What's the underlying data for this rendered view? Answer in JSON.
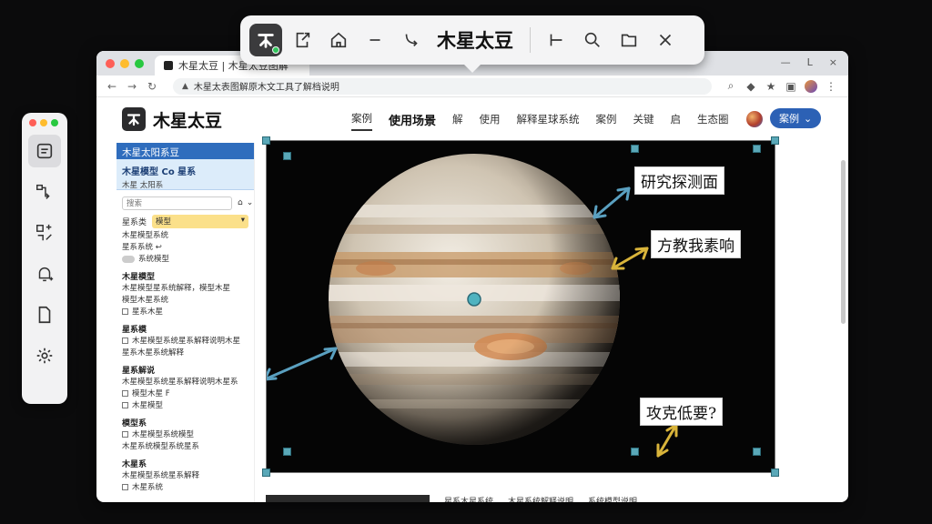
{
  "toolbar": {
    "title": "木星太豆",
    "buttons": [
      "app-logo-icon",
      "export-icon",
      "home-icon",
      "minus-icon",
      "curve-arrow-icon",
      "crop-icon",
      "zoom-icon",
      "frame-icon",
      "close-icon"
    ]
  },
  "left_panel": {
    "tools": [
      "note-icon",
      "connect-icon",
      "transform-icon",
      "alert-icon",
      "document-icon",
      "settings-icon"
    ]
  },
  "browser": {
    "tab_title": "木星太豆 | 木星太豆图解",
    "url": "木星太表图解原木文工具了解档说明",
    "controls": [
      "—",
      "L",
      "×"
    ]
  },
  "site": {
    "logo": "木星太豆",
    "nav": [
      "案例",
      "使用场景",
      "解",
      "使用",
      "解释星球系统",
      "案例",
      "关键",
      "启",
      "生态圈"
    ],
    "cta": "案例"
  },
  "sidebar": {
    "header": "木星太阳系豆",
    "box_title": "木星模型 Co 星系",
    "box_sub": "木星 太阳系",
    "search_placeholder": "搜索",
    "select_label": "星系类",
    "select_value": "模型",
    "lines1": [
      "木星模型系统",
      "星系系统 ↩"
    ],
    "toggle_label": "系统模型",
    "sec1": "木星模型",
    "sec1_lines": [
      "木星模型星系统解释，模型木星",
      "模型木星系统"
    ],
    "sec1_check": "星系木星",
    "sec2": "星系模",
    "sec2_lines": [
      "木星模型系统星系解释说明木星",
      "星系木星系统解释"
    ],
    "sec3": "星系解说",
    "sec3_lines": [
      "木星模型系统星系解释说明木星系",
      "模型木星 F",
      "木星模型"
    ],
    "sec4": "模型系",
    "sec4_lines": [
      "木星模型系统模型",
      "木星系统模型系统星系"
    ],
    "sec5": "木星系",
    "sec5_lines": [
      "木星模型系统星系解释",
      "木星系统"
    ]
  },
  "canvas": {
    "labels": [
      "研究探测面",
      "方教我素响",
      "攻克低要?"
    ]
  },
  "bottom": {
    "items": [
      "星系木星系统",
      "木星系统解释说明",
      "系统模型说明"
    ]
  },
  "colors": {
    "accent": "#2c61b5",
    "handle": "#5aa8b8",
    "arrow_blue": "#5aa0c0",
    "arrow_gold": "#d9b43a"
  }
}
